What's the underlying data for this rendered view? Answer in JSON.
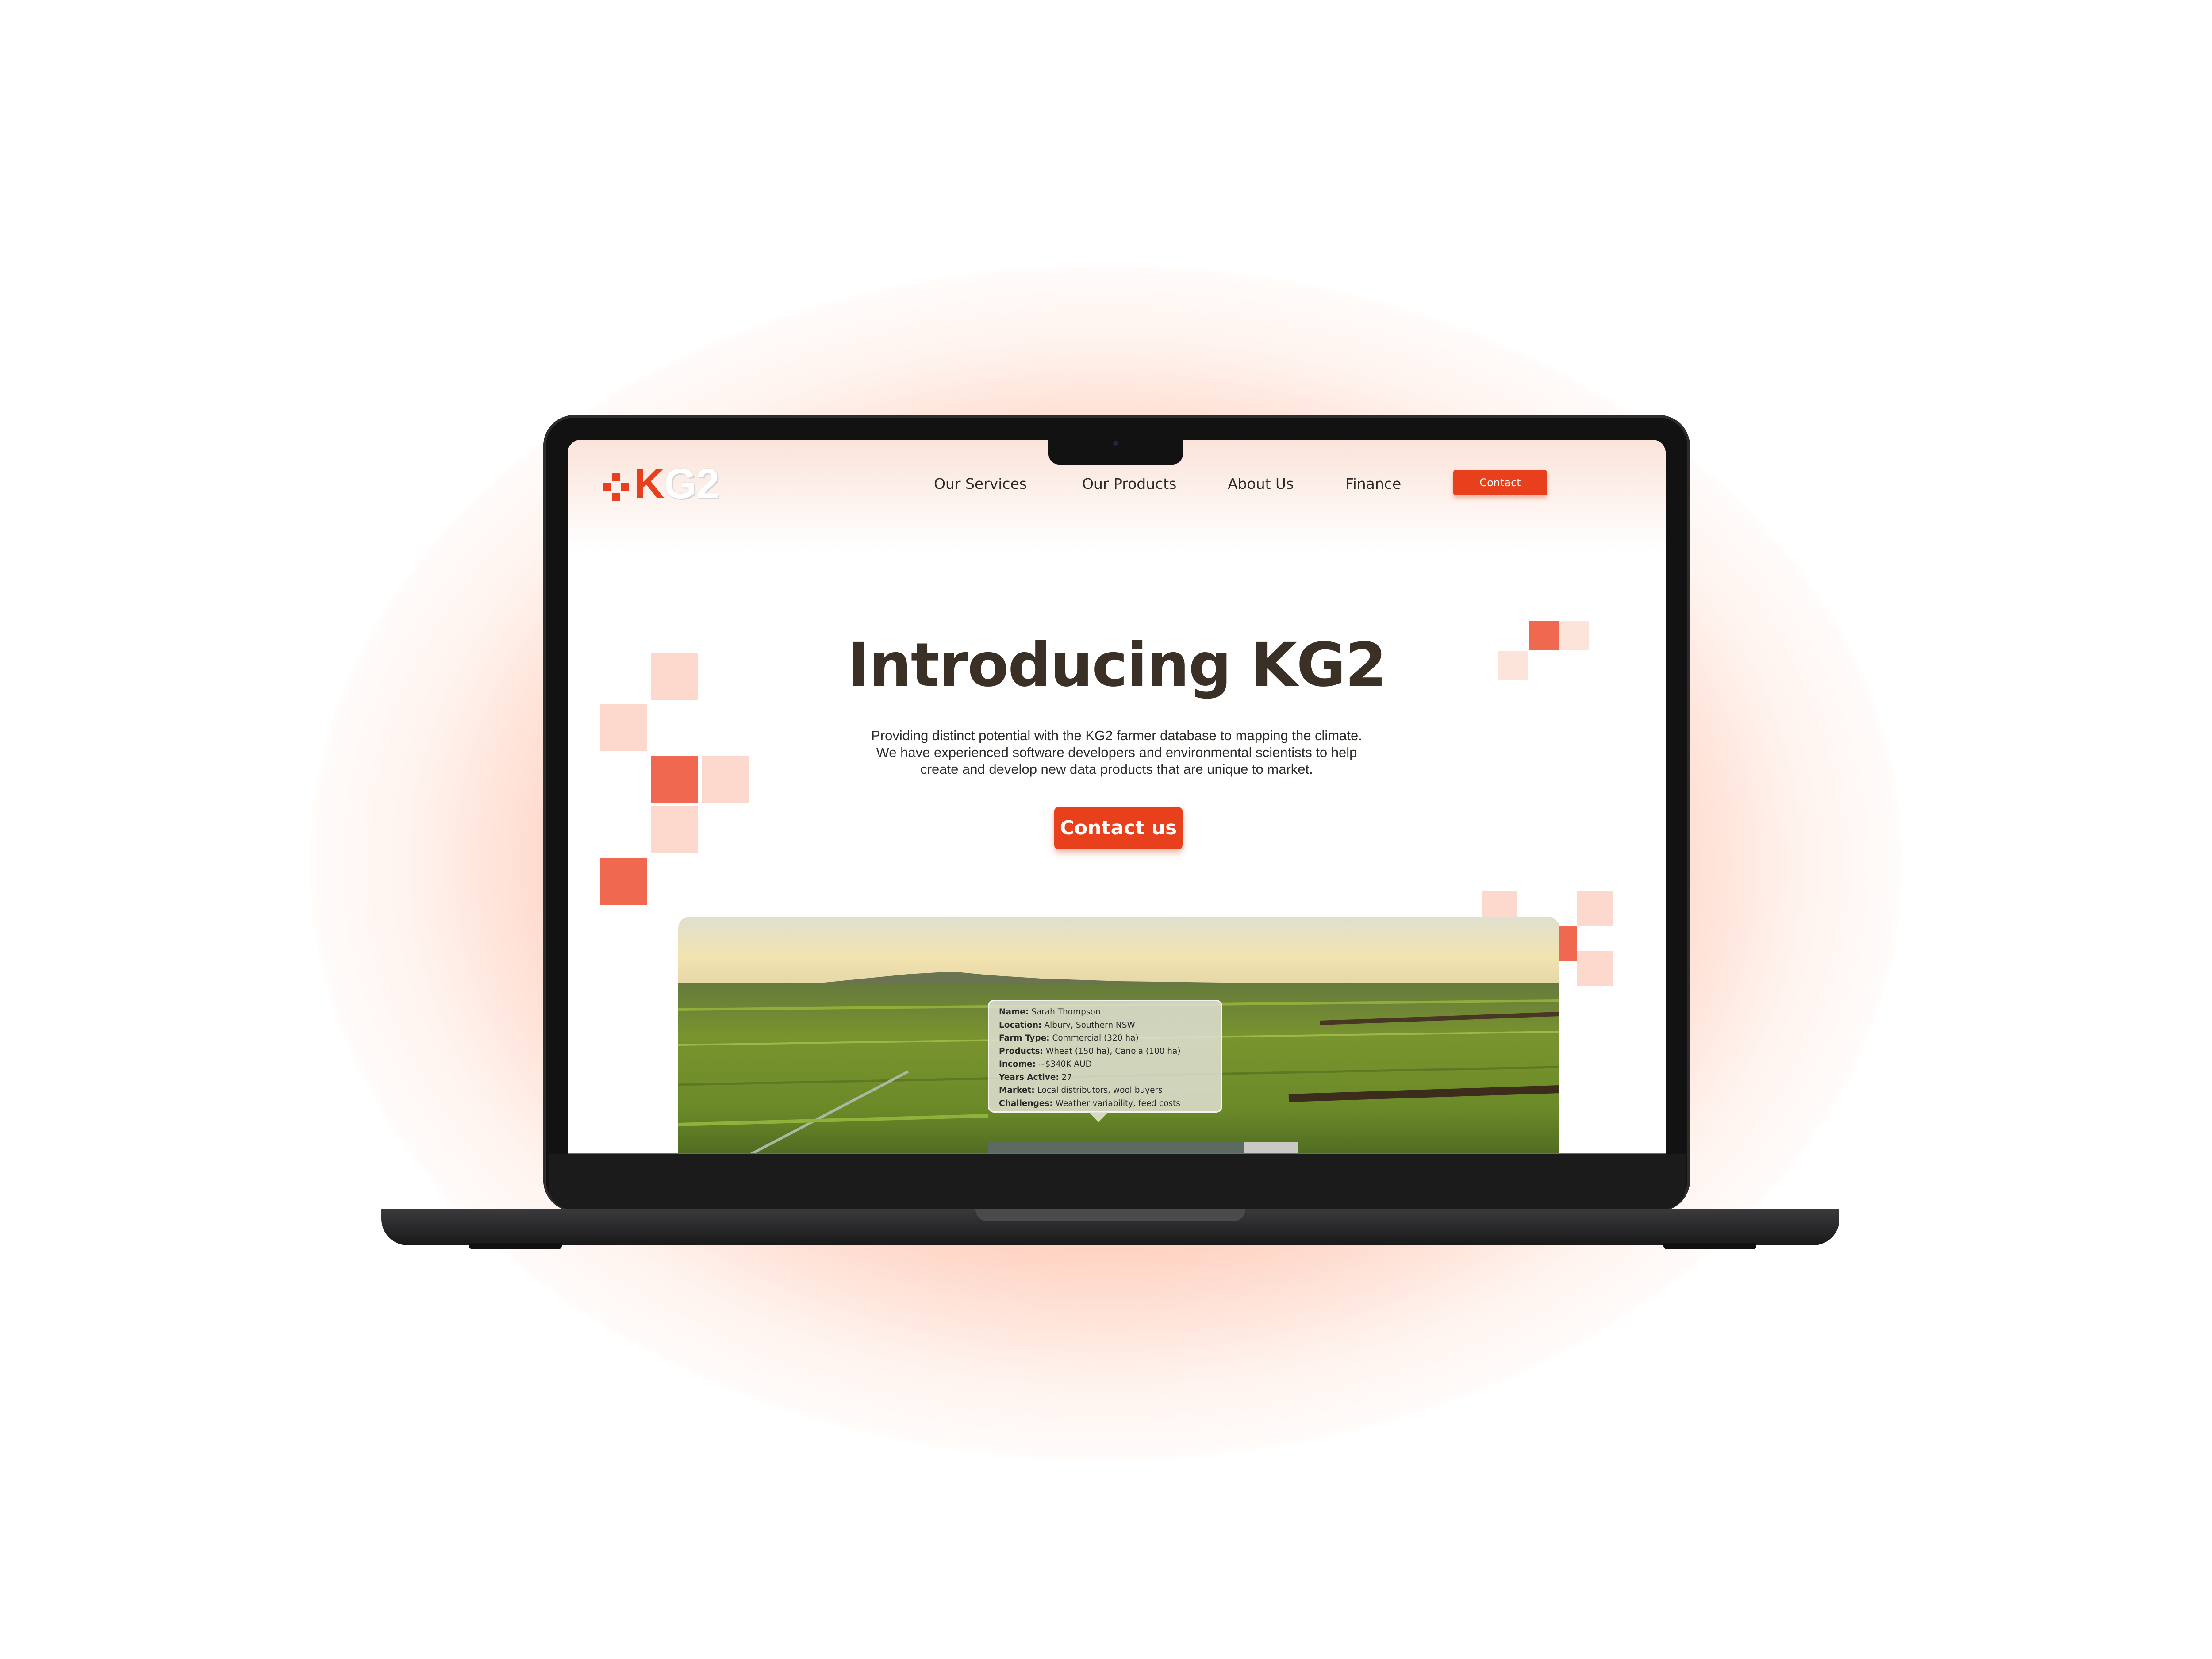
{
  "brand": {
    "logo_text": "KG2",
    "logo_letter": "K",
    "logo_rest": "G2",
    "accent": "#e8401c"
  },
  "nav": {
    "items": [
      {
        "label": "Our Services"
      },
      {
        "label": "Our Products"
      },
      {
        "label": "About Us"
      },
      {
        "label": "Finance"
      }
    ],
    "contact_label": "Contact"
  },
  "hero": {
    "title": "Introducing KG2",
    "description_lines": [
      "Providing distinct potential with the KG2 farmer database to mapping the climate.",
      "We have experienced software developers and environmental scientists to help",
      "create and develop new data products that are unique to market."
    ],
    "cta_label": "Contact us"
  },
  "farmer_card": {
    "rows": [
      {
        "key": "Name:",
        "value": "Sarah Thompson"
      },
      {
        "key": "Location:",
        "value": "Albury, Southern NSW"
      },
      {
        "key": "Farm Type:",
        "value": "Commercial (320 ha)"
      },
      {
        "key": "Products:",
        "value": "Wheat (150 ha), Canola (100 ha)"
      },
      {
        "key": "Income:",
        "value": "~$340K AUD"
      },
      {
        "key": "Years Active:",
        "value": "27"
      },
      {
        "key": "Market:",
        "value": "Local distributors, wool buyers"
      },
      {
        "key": "Challenges:",
        "value": "Weather variability, feed costs"
      }
    ]
  },
  "colors": {
    "text_dark": "#3b3026",
    "square_light": "#fcd9cc",
    "square_mid": "#f06850",
    "glow": "#ff7040"
  }
}
